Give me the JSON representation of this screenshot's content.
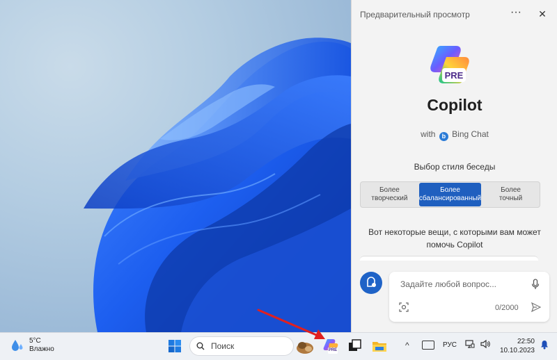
{
  "panel": {
    "header": "Предварительный просмотр",
    "more_icon": "more-dots-icon",
    "close_icon": "close-icon",
    "logo_badge": "PRE",
    "title": "Copilot",
    "with_prefix": "with",
    "with_service": "Bing Chat",
    "style_label": "Выбор стиля беседы",
    "styles": [
      {
        "line1": "Более",
        "line2": "творческий",
        "active": false
      },
      {
        "line1": "Более",
        "line2": "сбалансированный",
        "active": true
      },
      {
        "line1": "Более",
        "line2": "точный",
        "active": false
      }
    ],
    "help_text": "Вот некоторые вещи, с которыми вам может помочь Copilot",
    "input_placeholder": "Задайте любой вопрос...",
    "counter": "0/2000",
    "accent": "#1f5fbf"
  },
  "taskbar": {
    "weather_temp": "5°C",
    "weather_desc": "Влажно",
    "search_label": "Поиск",
    "copilot_badge": "PRE",
    "lang": "РУС",
    "time": "22:50",
    "date": "10.10.2023"
  }
}
